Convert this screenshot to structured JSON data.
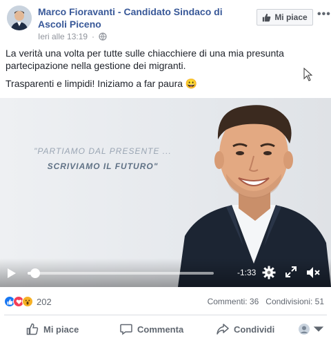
{
  "header": {
    "page_name": "Marco Fioravanti - Candidato Sindaco di Ascoli Piceno",
    "timestamp": "Ieri alle 13:19",
    "separator": "·",
    "like_page_label": "Mi piace",
    "more_glyph": "•••"
  },
  "post": {
    "text_1": "La verità una volta per tutte sulle chiacchiere di una mia presunta partecipazione nella gestione dei migranti.",
    "text_2": "Trasparenti e limpidi! Iniziamo a far paura 😀"
  },
  "video": {
    "slogan_line_1": "\"PARTIAMO DAL PRESENTE ...",
    "slogan_line_2": "SCRIVIAMO IL FUTURO\"",
    "time_remaining": "-1:33",
    "progress_fraction": 0.04
  },
  "reactions": {
    "count": "202",
    "comments": "Commenti: 36",
    "shares": "Condivisioni: 51",
    "icons": [
      "like-reaction-icon",
      "love-reaction-icon",
      "wow-reaction-icon"
    ],
    "colors": {
      "like": "#1877f2",
      "love": "#f33e58",
      "wow": "#f7b125"
    }
  },
  "actions": {
    "like": "Mi piace",
    "comment": "Commenta",
    "share": "Condividi"
  },
  "colors": {
    "link": "#385898",
    "muted": "#90949c"
  }
}
